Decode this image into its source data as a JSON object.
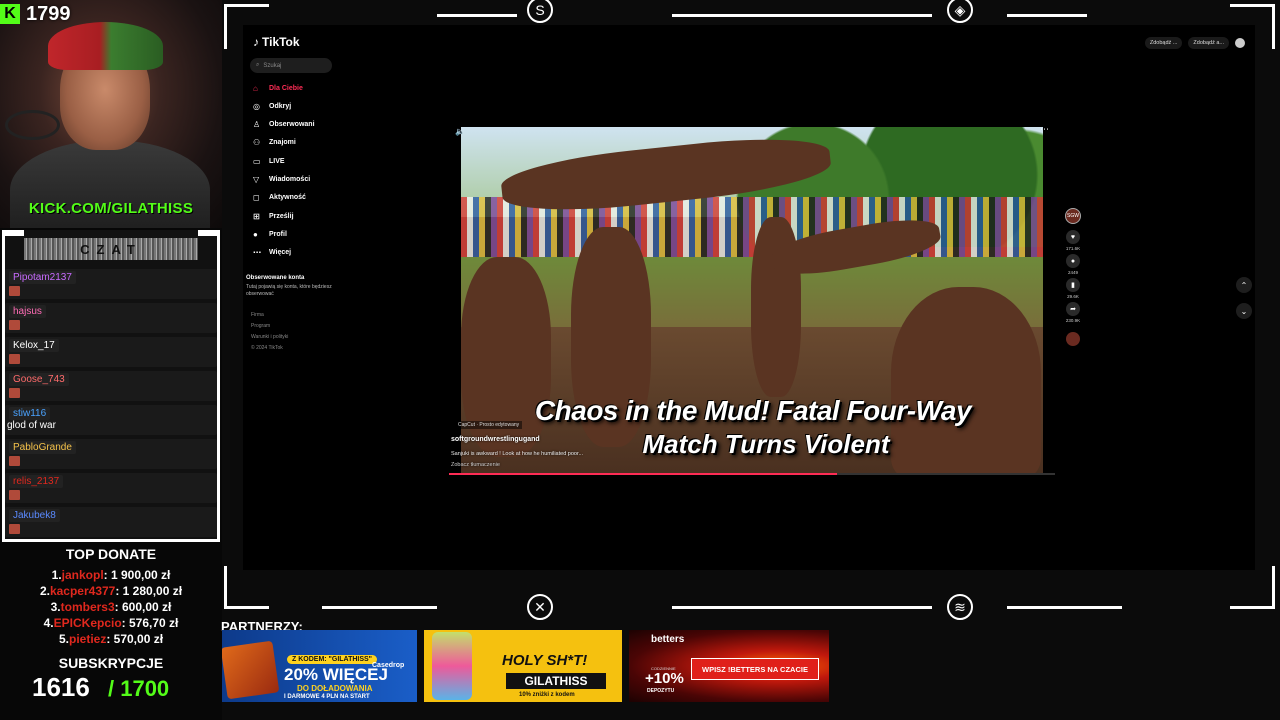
{
  "stream": {
    "viewer_count": "1799",
    "kick_logo": "K",
    "url": "KICK.COM/GILATHISS"
  },
  "chat": {
    "title": "CZAT",
    "messages": [
      {
        "user": "Pipotam2137",
        "color": "#c86bff",
        "badge": false,
        "text": ""
      },
      {
        "user": "hajsus",
        "color": "#ff6bb5",
        "badge": true,
        "text": ""
      },
      {
        "user": "Kelox_17",
        "color": "#ffffff",
        "badge": false,
        "text": ""
      },
      {
        "user": "Goose_743",
        "color": "#ff6b6b",
        "badge": false,
        "text": ""
      },
      {
        "user": "stiw116",
        "color": "#4aa3ff",
        "badge": true,
        "text": "glod of war"
      },
      {
        "user": "PabloGrande",
        "color": "#f5c24a",
        "badge": true,
        "text": ""
      },
      {
        "user": "relis_2137",
        "color": "#e0281e",
        "badge": true,
        "text": ""
      },
      {
        "user": "Jakubek8",
        "color": "#5a8aff",
        "badge": false,
        "text": ""
      }
    ]
  },
  "top_donate": {
    "title": "TOP DONATE",
    "entries": [
      {
        "rank": "1.",
        "name": "jankopl",
        "amount": ": 1 900,00 zł"
      },
      {
        "rank": "2.",
        "name": "kacper4377",
        "amount": ": 1 280,00 zł"
      },
      {
        "rank": "3.",
        "name": "tombers3",
        "amount": ": 600,00 zł"
      },
      {
        "rank": "4.",
        "name": "EPICKepcio",
        "amount": ": 576,70 zł"
      },
      {
        "rank": "5.",
        "name": "pietiez",
        "amount": ": 570,00 zł"
      }
    ]
  },
  "subs": {
    "title": "SUBSKRYPCJE",
    "current": "1616",
    "goal": "/ 1700"
  },
  "tiktok": {
    "logo_text": "TikTok",
    "search_placeholder": "Szukaj",
    "nav": [
      {
        "label": "Dla Ciebie",
        "icon": "home-icon",
        "active": true
      },
      {
        "label": "Odkryj",
        "icon": "compass-icon",
        "active": false
      },
      {
        "label": "Obserwowani",
        "icon": "following-icon",
        "active": false
      },
      {
        "label": "Znajomi",
        "icon": "friends-icon",
        "active": false
      },
      {
        "label": "LIVE",
        "icon": "live-icon",
        "active": false
      },
      {
        "label": "Wiadomości",
        "icon": "messages-icon",
        "active": false
      },
      {
        "label": "Aktywność",
        "icon": "activity-icon",
        "active": false
      },
      {
        "label": "Prześlij",
        "icon": "upload-icon",
        "active": false
      },
      {
        "label": "Profil",
        "icon": "profile-icon",
        "active": false
      },
      {
        "label": "Więcej",
        "icon": "more-icon",
        "active": false
      }
    ],
    "followed_title": "Obserwowane konta",
    "followed_text": "Tutaj pojawią się konta, które będziesz obserwować",
    "footer_links": [
      "Firma",
      "Program",
      "Warunki i polityki",
      "© 2024 TikTok"
    ],
    "top_buttons": [
      "Zdobądź ...",
      "Zdobądź a..."
    ],
    "accent": "#fe2c55"
  },
  "video": {
    "title_line1": "Chaos in the Mud! Fatal Four-Way",
    "title_line2": "Match Turns Violent",
    "capcut_label": "CapCut · Prosto edytowany",
    "author": "softgroundwrestlingugand",
    "description": "Sanjuki is awkward ! Look at how he humiliated poor...",
    "see_more": "Zobacz tłumaczenie",
    "progress": 0.64,
    "likes": "171.6K",
    "comments": "2449",
    "saves": "29.6K",
    "shares": "230.9K",
    "avatar_text": "SGW"
  },
  "partners": {
    "label": "PARTNERZY:",
    "ad1": {
      "code": "Z KODEM: \"GILATHISS\"",
      "big": "20% WIĘCEJ",
      "mid": "DO DOŁADOWANIA",
      "small": "I DARMOWE 4 PLN NA START",
      "logo": "Casedrop"
    },
    "ad2": {
      "title": "HOLY SH*T!",
      "code": "GILATHISS",
      "small": "10% zniżki z kodem"
    },
    "ad3": {
      "brand": "betters",
      "label": "CODZIENNIE",
      "pct": "+10%",
      "dep": "DEPOZYTU",
      "cta": "WPISZ !BETTERS NA CZACIE"
    }
  }
}
